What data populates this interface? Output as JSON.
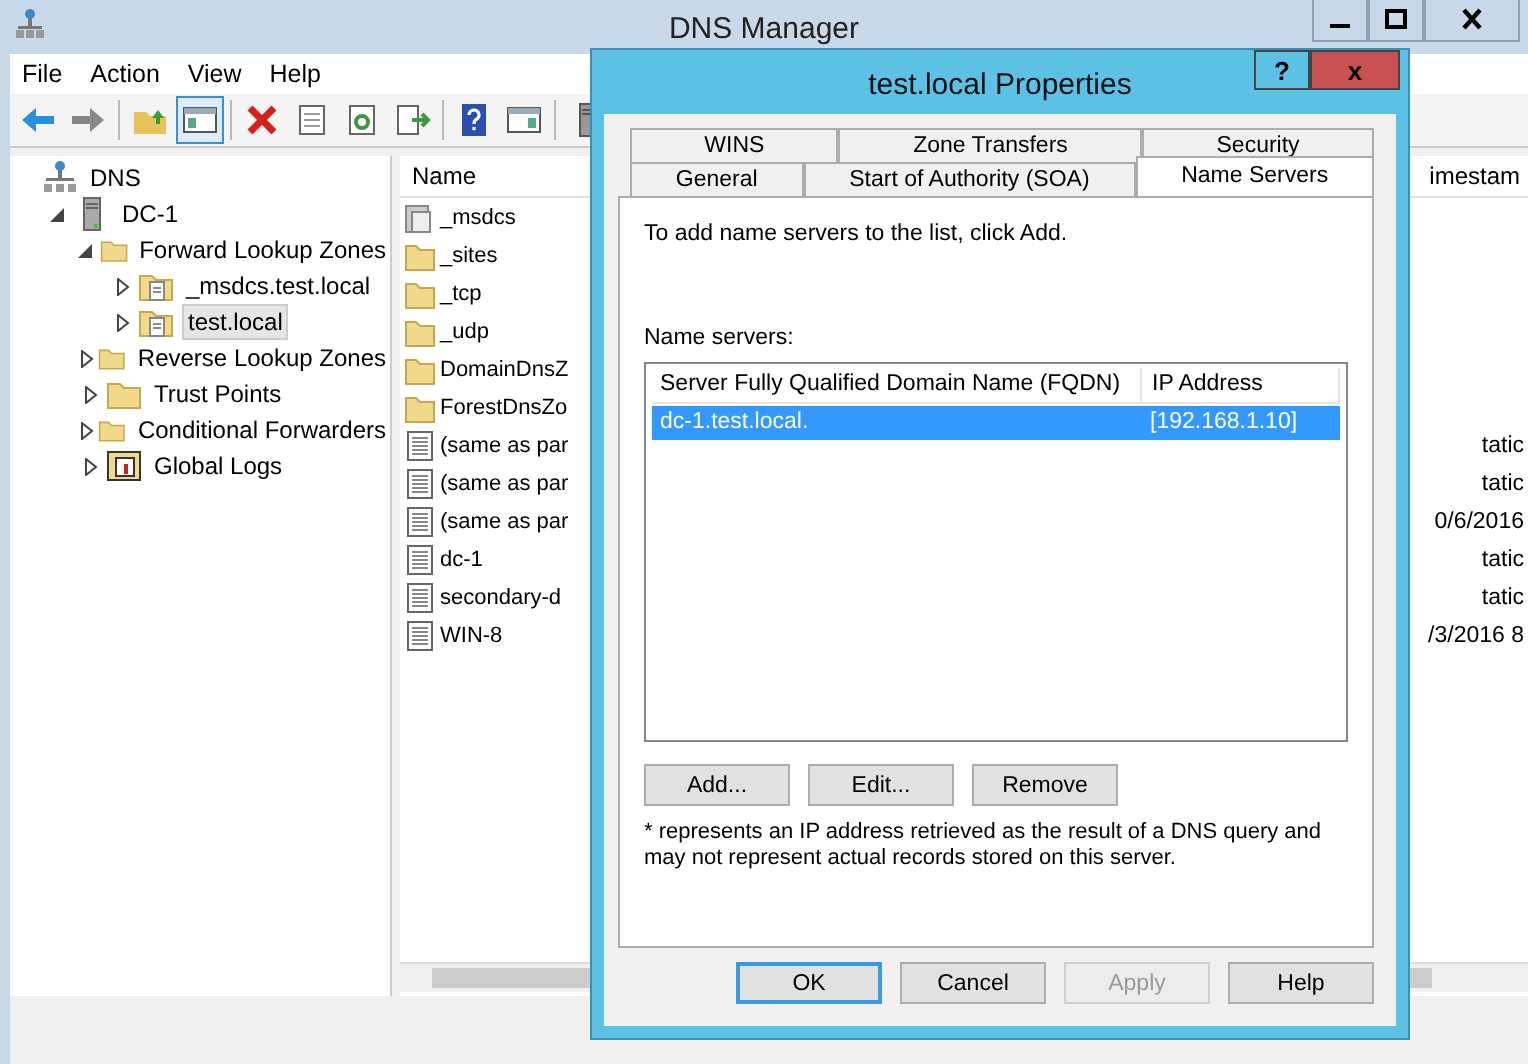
{
  "window": {
    "title": "DNS Manager"
  },
  "menu": [
    "File",
    "Action",
    "View",
    "Help"
  ],
  "toolbar": [
    {
      "kind": "back",
      "selected": false
    },
    {
      "kind": "forward",
      "selected": false
    },
    {
      "kind": "up",
      "selected": false
    },
    {
      "kind": "tree",
      "selected": true
    },
    {
      "kind": "delete",
      "selected": false
    },
    {
      "kind": "properties",
      "selected": false
    },
    {
      "kind": "refresh",
      "selected": false
    },
    {
      "kind": "export",
      "selected": false
    },
    {
      "kind": "help",
      "selected": false
    },
    {
      "kind": "pane",
      "selected": false
    },
    {
      "kind": "server",
      "selected": false
    }
  ],
  "tree": [
    {
      "label": "DNS",
      "kind": "dns",
      "selected": false,
      "children": [
        {
          "label": "DC-1",
          "kind": "server",
          "expanded": true,
          "selected": false,
          "children": [
            {
              "label": "Forward Lookup Zones",
              "kind": "folder",
              "expanded": true,
              "selected": false,
              "children": [
                {
                  "label": "_msdcs.test.local",
                  "kind": "zone",
                  "expanded": false,
                  "selected": false
                },
                {
                  "label": "test.local",
                  "kind": "zone",
                  "expanded": false,
                  "selected": true
                }
              ]
            },
            {
              "label": "Reverse Lookup Zones",
              "kind": "folder",
              "expanded": false,
              "selected": false
            },
            {
              "label": "Trust Points",
              "kind": "folder",
              "expanded": false,
              "selected": false
            },
            {
              "label": "Conditional Forwarders",
              "kind": "folder",
              "expanded": false,
              "selected": false
            },
            {
              "label": "Global Logs",
              "kind": "log",
              "expanded": false,
              "selected": false
            }
          ]
        }
      ]
    }
  ],
  "list": {
    "columns": [
      "Name",
      "imestam"
    ],
    "rows": [
      {
        "kind": "zone",
        "name": "_msdcs"
      },
      {
        "kind": "folder",
        "name": "_sites"
      },
      {
        "kind": "folder",
        "name": "_tcp"
      },
      {
        "kind": "folder",
        "name": "_udp"
      },
      {
        "kind": "folder",
        "name": "DomainDnsZ"
      },
      {
        "kind": "folder",
        "name": "ForestDnsZo"
      },
      {
        "kind": "record",
        "name": "(same as par",
        "timestamp": "tatic"
      },
      {
        "kind": "record",
        "name": "(same as par",
        "timestamp": "tatic"
      },
      {
        "kind": "record",
        "name": "(same as par",
        "timestamp": "0/6/2016"
      },
      {
        "kind": "record",
        "name": "dc-1",
        "timestamp": "tatic"
      },
      {
        "kind": "record",
        "name": "secondary-d",
        "timestamp": "tatic"
      },
      {
        "kind": "record",
        "name": "WIN-8",
        "timestamp": "/3/2016 8"
      }
    ]
  },
  "dialog": {
    "title": "test.local Properties",
    "help_button": "?",
    "close_button": "x",
    "tab_rows": [
      {
        "tabs": [
          {
            "label": "WINS",
            "selected": false
          },
          {
            "label": "Zone Transfers",
            "selected": false
          },
          {
            "label": "Security",
            "selected": false
          }
        ]
      },
      {
        "tabs": [
          {
            "label": "General",
            "selected": false
          },
          {
            "label": "Start of Authority (SOA)",
            "selected": false
          },
          {
            "label": "Name Servers",
            "selected": true
          }
        ]
      }
    ],
    "intro": "To add name servers to the list, click Add.",
    "list_label": "Name servers:",
    "columns": [
      "Server Fully Qualified Domain Name (FQDN)",
      "IP Address"
    ],
    "servers": [
      {
        "fqdn": "dc-1.test.local.",
        "ip": "[192.168.1.10]",
        "selected": true
      }
    ],
    "list_buttons": [
      "Add...",
      "Edit...",
      "Remove"
    ],
    "note": "* represents an IP address retrieved as the result of a DNS query and may not represent actual records stored on this server.",
    "buttons": [
      {
        "label": "OK",
        "disabled": false,
        "default": true
      },
      {
        "label": "Cancel",
        "disabled": false,
        "default": false
      },
      {
        "label": "Apply",
        "disabled": true,
        "default": false
      },
      {
        "label": "Help",
        "disabled": false,
        "default": false
      }
    ]
  }
}
